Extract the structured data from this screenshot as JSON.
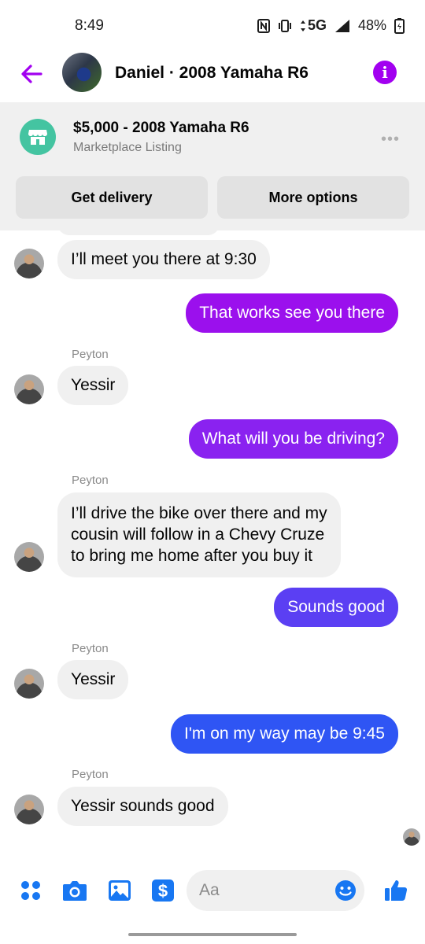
{
  "status_bar": {
    "time": "8:49",
    "network": "5G",
    "battery": "48%"
  },
  "header": {
    "contact_title": "Daniel · 2008 Yamaha R6"
  },
  "listing": {
    "title": "$5,000 - 2008 Yamaha R6",
    "subtitle": "Marketplace Listing",
    "more_label": "•••",
    "delivery_label": "Get delivery",
    "options_label": "More options"
  },
  "messages": [
    {
      "from": "other",
      "text": "I’ll meet you there at 9:30"
    },
    {
      "from": "me",
      "text": "That works see you there",
      "color": "#9b10ed"
    },
    {
      "from": "other",
      "sender": "Peyton",
      "text": "Yessir"
    },
    {
      "from": "me",
      "text": "What will you be driving?",
      "color": "#8a22f0"
    },
    {
      "from": "other",
      "sender": "Peyton",
      "lines": [
        "I’ll drive the bike over there and my",
        "cousin will follow in a Chevy Cruze",
        "to bring me home after you buy it"
      ]
    },
    {
      "from": "me",
      "text": "Sounds good",
      "color": "#5b3ff3"
    },
    {
      "from": "other",
      "sender": "Peyton",
      "text": "Yessir"
    },
    {
      "from": "me",
      "text": "I'm on my way may be 9:45",
      "color": "#2f55f4"
    },
    {
      "from": "other",
      "sender": "Peyton",
      "text": "Yessir sounds good"
    }
  ],
  "composer": {
    "placeholder": "Aa"
  },
  "icons": {
    "back": "arrow-left-icon",
    "info": "info-icon",
    "store": "store-icon",
    "menu": "four-dots-icon",
    "camera": "camera-icon",
    "gallery": "image-icon",
    "payment": "dollar-icon",
    "emoji": "smiley-icon",
    "like": "thumbs-up-icon"
  },
  "colors": {
    "accent": "#a200f0",
    "composer_blue": "#1877f2",
    "listing_icon": "#44c4a1"
  }
}
